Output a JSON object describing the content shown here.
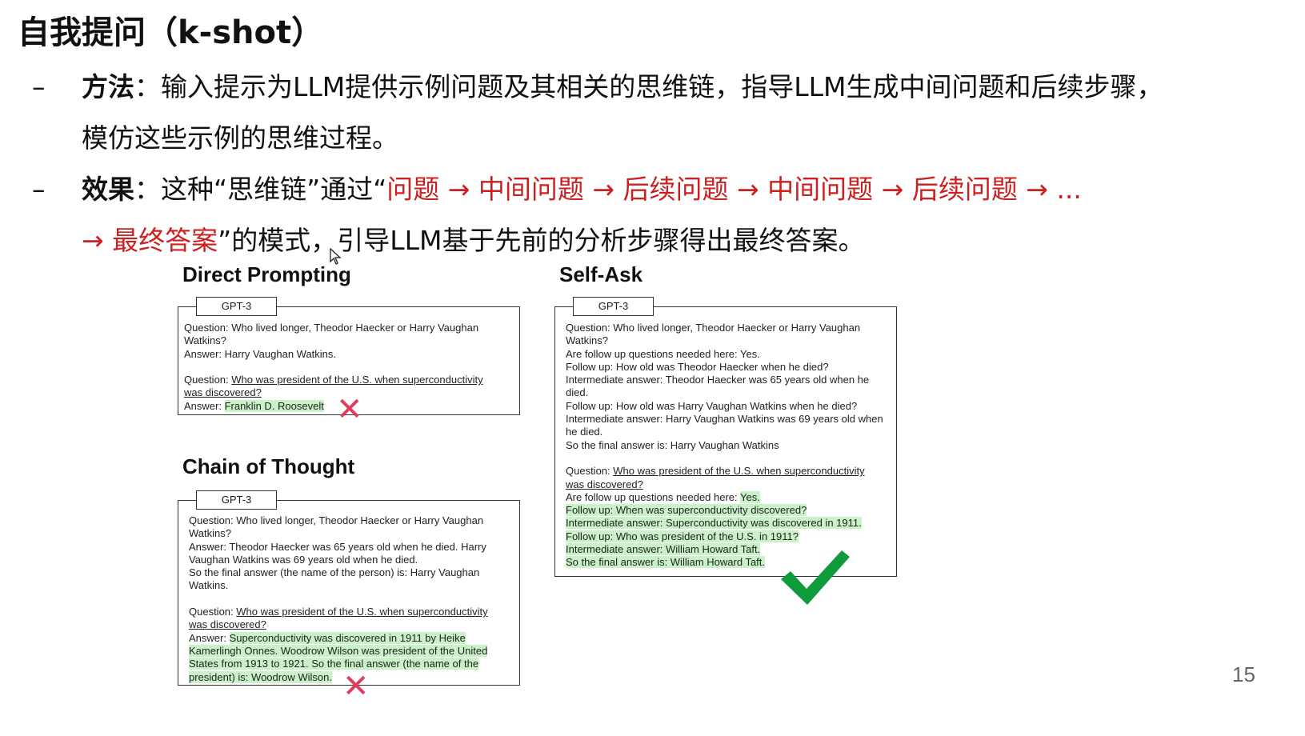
{
  "title": "自我提问（k-shot）",
  "bullets": {
    "dash": "–",
    "method_label": "方法",
    "method_text_1": "：输入提示为LLM提供示例问题及其相关的思维链，指导LLM生成中间问题和后续步骤，",
    "method_text_2": "模仿这些示例的思维过程。",
    "effect_label": "效果",
    "effect_text_a": "：这种“思维链”通过“",
    "effect_red_1": "问题 → 中间问题 → 后续问题 → 中间问题 → 后续问题 → ...",
    "effect_red_2": "→ 最终答案",
    "effect_text_b": "”的模式，引导LLM基于先前的分析步骤得出最终答案。"
  },
  "direct": {
    "heading": "Direct Prompting",
    "tab": "GPT-3",
    "lines": [
      "Question: Who lived longer, Theodor Haecker or Harry Vaughan",
      "Watkins?",
      "Answer: Harry Vaughan Watkins."
    ],
    "q2_prefix": "Question: ",
    "q2_u1": "Who was president of the U.S. when superconductivity",
    "q2_u2": "was discovered?",
    "ans_prefix": "Answer: ",
    "ans_hl": "Franklin D. Roosevelt",
    "mark": "✕"
  },
  "cot": {
    "heading": "Chain of Thought",
    "tab": "GPT-3",
    "lines": [
      "Question: Who lived longer, Theodor Haecker or Harry Vaughan",
      "Watkins?",
      "Answer: Theodor Haecker was 65 years old when he died. Harry",
      "Vaughan Watkins was 69 years old when he died.",
      "So the final answer (the name of the person) is: Harry Vaughan",
      "Watkins."
    ],
    "q2_prefix": "Question: ",
    "q2_u1": "Who was president of the U.S. when superconductivity",
    "q2_u2": "was discovered?",
    "ans_prefix": "Answer: ",
    "ans_hl": [
      "Superconductivity was discovered in 1911 by Heike",
      "Kamerlingh Onnes. Woodrow Wilson was president of the United",
      "States from 1913 to 1921. So the final answer (the name of the",
      "president) is: Woodrow Wilson."
    ],
    "mark": "✕"
  },
  "selfask": {
    "heading": "Self-Ask",
    "tab": "GPT-3",
    "lines": [
      "Question: Who lived longer, Theodor Haecker or Harry Vaughan",
      "Watkins?",
      "Are follow up questions needed here: Yes.",
      "Follow up: How old was Theodor Haecker when he died?",
      "Intermediate answer: Theodor Haecker was 65 years old when he",
      "died.",
      "Follow up: How old was Harry Vaughan Watkins when he died?",
      "Intermediate answer: Harry Vaughan Watkins was 69 years old when",
      "he died.",
      "So the final answer is: Harry Vaughan Watkins"
    ],
    "q2_prefix": "Question: ",
    "q2_u1": "Who was president of the U.S. when superconductivity",
    "q2_u2": "was discovered?",
    "followup_prefix": "Are follow up questions needed here: ",
    "followup_hl": "Yes.",
    "hl_lines": [
      "Follow up: When was superconductivity discovered?",
      "Intermediate answer: Superconductivity was discovered in 1911.",
      "Follow up: Who was president of the U.S. in 1911?",
      "Intermediate answer: William Howard Taft.",
      "So the final answer is: William Howard Taft."
    ]
  },
  "page_number": "15",
  "colors": {
    "red_text": "#cc1f1f",
    "highlight": "#c9f2c9",
    "cross": "#e23c5c",
    "check": "#0f9a3c"
  }
}
